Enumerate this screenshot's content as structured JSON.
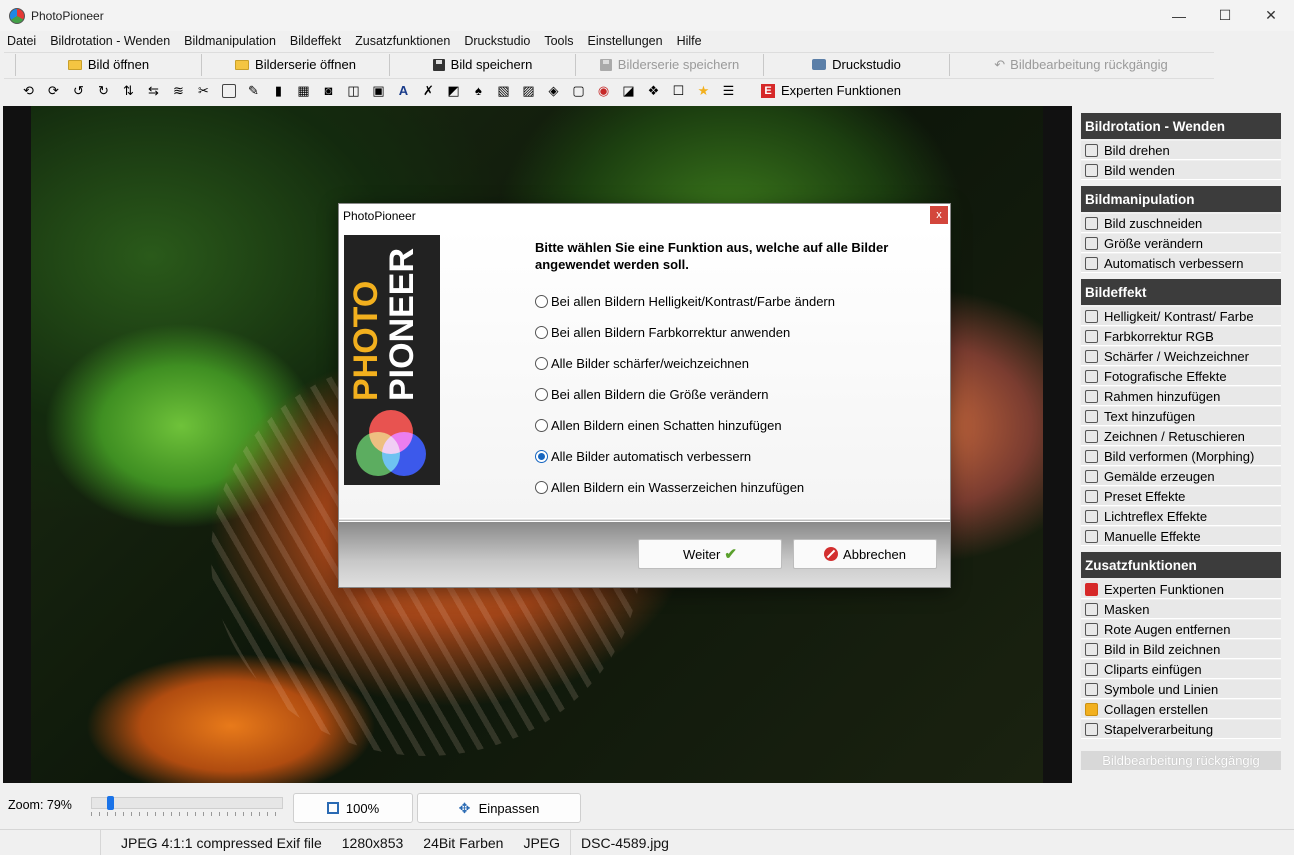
{
  "window": {
    "title": "PhotoPioneer",
    "minimize": "—",
    "maximize": "☐",
    "close": "✕"
  },
  "menu": [
    "Datei",
    "Bildrotation - Wenden",
    "Bildmanipulation",
    "Bildeffekt",
    "Zusatzfunktionen",
    "Druckstudio",
    "Tools",
    "Einstellungen",
    "Hilfe"
  ],
  "toolbar": {
    "open_image": "Bild öffnen",
    "open_series": "Bilderserie öffnen",
    "save_image": "Bild speichern",
    "save_series": "Bilderserie speichern",
    "print_studio": "Druckstudio",
    "undo": "Bildbearbeitung rückgängig",
    "expert": "Experten Funktionen",
    "expert_badge": "E"
  },
  "zoom": {
    "label": "Zoom: 79%",
    "level_percent": 79,
    "btn_100": "100%",
    "btn_fit": "Einpassen"
  },
  "status": [
    "JPEG 4:1:1 compressed Exif file",
    "1280x853",
    "24Bit Farben",
    "JPEG",
    "DSC-4589.jpg"
  ],
  "sidebar": {
    "sections": [
      {
        "title": "Bildrotation - Wenden",
        "items": [
          "Bild drehen",
          "Bild wenden"
        ]
      },
      {
        "title": "Bildmanipulation",
        "items": [
          "Bild zuschneiden",
          "Größe verändern",
          "Automatisch verbessern"
        ]
      },
      {
        "title": "Bildeffekt",
        "items": [
          "Helligkeit/ Kontrast/ Farbe",
          "Farbkorrektur RGB",
          "Schärfer / Weichzeichner",
          "Fotografische Effekte",
          "Rahmen hinzufügen",
          "Text hinzufügen",
          "Zeichnen / Retuschieren",
          "Bild verformen (Morphing)",
          "Gemälde erzeugen",
          "Preset Effekte",
          "Lichtreflex Effekte",
          "Manuelle Effekte"
        ]
      },
      {
        "title": "Zusatzfunktionen",
        "items": [
          "Experten Funktionen",
          "Masken",
          "Rote Augen entfernen",
          "Bild in Bild zeichnen",
          "Cliparts einfügen",
          "Symbole und Linien",
          "Collagen erstellen",
          "Stapelverarbeitung"
        ]
      }
    ],
    "undo": "Bildbearbeitung rückgängig"
  },
  "dialog": {
    "title": "PhotoPioneer",
    "close": "x",
    "logo_photo": "PHOTO",
    "logo_pioneer": "PIONEER",
    "heading_line1": "Bitte wählen Sie eine Funktion aus, welche auf alle Bilder",
    "heading_line2": "angewendet werden soll.",
    "options": [
      {
        "label": "Bei allen Bildern Helligkeit/Kontrast/Farbe ändern",
        "checked": false
      },
      {
        "label": "Bei allen Bildern Farbkorrektur anwenden",
        "checked": false
      },
      {
        "label": "Alle Bilder schärfer/weichzeichnen",
        "checked": false
      },
      {
        "label": "Bei allen Bildern die Größe verändern",
        "checked": false
      },
      {
        "label": "Allen Bildern einen Schatten hinzufügen",
        "checked": false
      },
      {
        "label": "Alle Bilder automatisch verbessern",
        "checked": true
      },
      {
        "label": "Allen Bildern ein Wasserzeichen hinzufügen",
        "checked": false
      }
    ],
    "next": "Weiter",
    "cancel": "Abbrechen"
  },
  "colors": {
    "accent": "#1565c0",
    "sidebar_header": "#3c3c3c",
    "logo_orange": "#f2b01e"
  }
}
